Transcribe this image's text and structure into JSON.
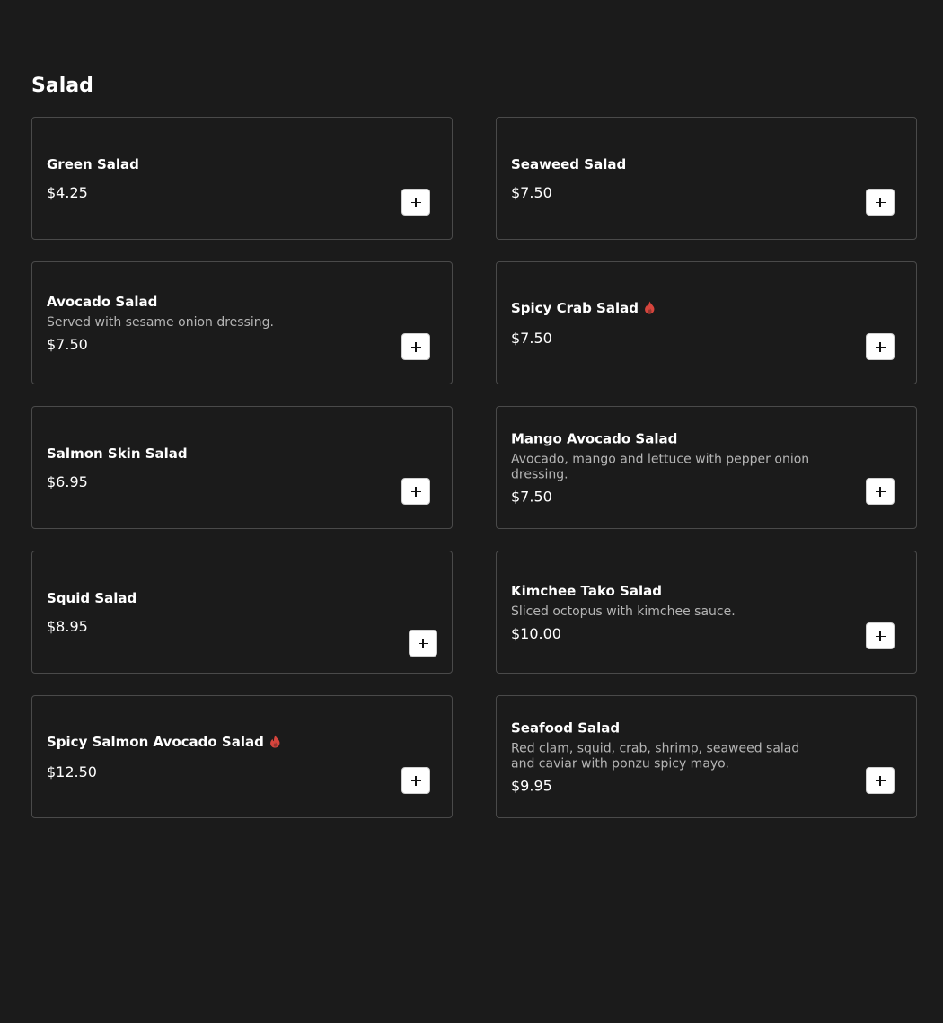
{
  "section": {
    "title": "Salad"
  },
  "colors": {
    "background": "#1b1b1b",
    "card_border": "#4a4a4a",
    "description": "#b5b5b5",
    "spicy": "#d6453d"
  },
  "items": [
    {
      "name": "Green Salad",
      "description": "",
      "price": "$4.25",
      "spicy": false,
      "action_icon": "plus-icon"
    },
    {
      "name": "Seaweed Salad",
      "description": "",
      "price": "$7.50",
      "spicy": false,
      "action_icon": "plus-icon"
    },
    {
      "name": "Avocado Salad",
      "description": "Served with sesame onion dressing.",
      "price": "$7.50",
      "spicy": false,
      "action_icon": "plus-icon"
    },
    {
      "name": "Spicy Crab Salad",
      "description": "",
      "price": "$7.50",
      "spicy": true,
      "action_icon": "plus-icon"
    },
    {
      "name": "Salmon Skin Salad",
      "description": "",
      "price": "$6.95",
      "spicy": false,
      "action_icon": "plus-icon"
    },
    {
      "name": "Mango Avocado Salad",
      "description": "Avocado, mango and lettuce with pepper onion dressing.",
      "price": "$7.50",
      "spicy": false,
      "action_icon": "plus-icon"
    },
    {
      "name": "Squid Salad",
      "description": "",
      "price": "$8.95",
      "spicy": false,
      "action_icon": "plus-icon"
    },
    {
      "name": "Kimchee Tako Salad",
      "description": "Sliced octopus with kimchee sauce.",
      "price": "$10.00",
      "spicy": false,
      "action_icon": "plus-icon"
    },
    {
      "name": "Spicy Salmon Avocado Salad",
      "description": "",
      "price": "$12.50",
      "spicy": true,
      "action_icon": "plus-icon"
    },
    {
      "name": "Seafood Salad",
      "description": "Red clam, squid, crab, shrimp, seaweed salad and caviar with ponzu spicy mayo.",
      "price": "$9.95",
      "spicy": false,
      "action_icon": "plus-icon"
    }
  ]
}
